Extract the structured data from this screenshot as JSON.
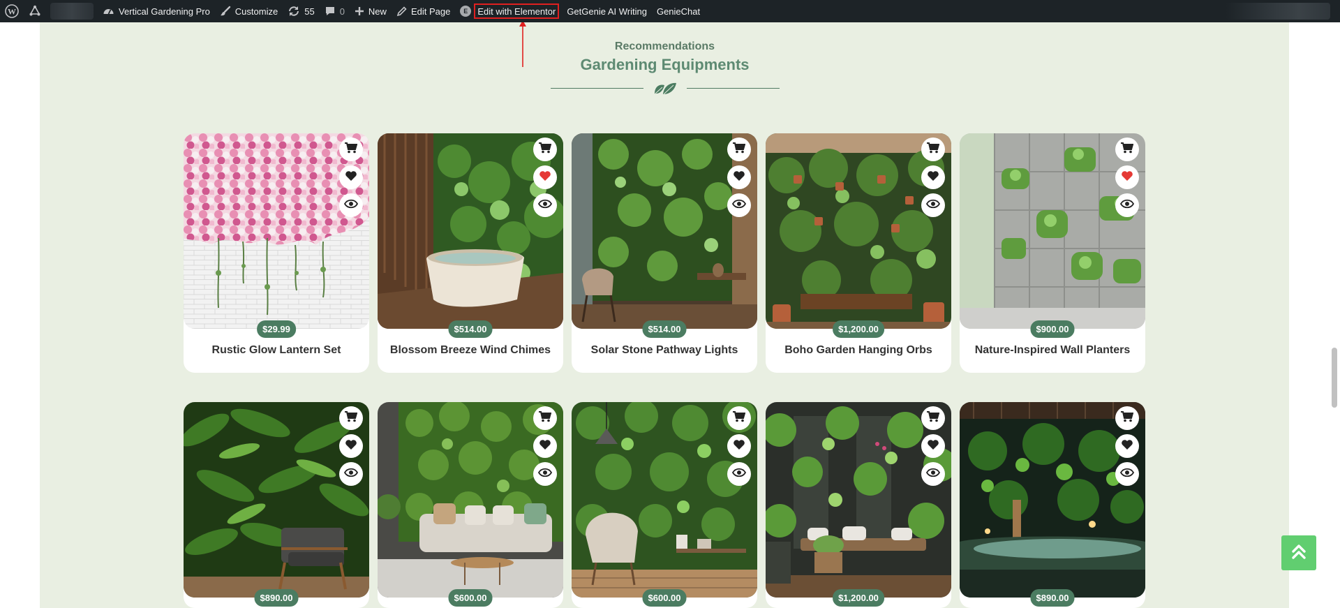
{
  "adminbar": {
    "site_name": "Vertical Gardening Pro",
    "customize": "Customize",
    "updates_count": "55",
    "comments_count": "0",
    "new": "New",
    "edit_page": "Edit Page",
    "elementor_badge": "E",
    "edit_elementor": "Edit with Elementor",
    "getgenie": "GetGenie AI Writing",
    "geniechat": "GenieChat"
  },
  "section": {
    "subtitle": "Recommendations",
    "title": "Gardening Equipments"
  },
  "colors": {
    "accent": "#4b7c61",
    "page_bg": "#e9efe2",
    "heart_active": "#e53935",
    "scroll_top": "#61ce70"
  },
  "products": [
    {
      "name": "Rustic Glow Lantern Set",
      "price": "$29.99",
      "wishlisted": false,
      "image": "pink-rose-wall-image"
    },
    {
      "name": "Blossom Breeze Wind Chimes",
      "price": "$514.00",
      "wishlisted": true,
      "image": "bathtub-green-wall-image"
    },
    {
      "name": "Solar Stone Pathway Lights",
      "price": "$514.00",
      "wishlisted": false,
      "image": "green-wall-chair-image"
    },
    {
      "name": "Boho Garden Hanging Orbs",
      "price": "$1,200.00",
      "wishlisted": false,
      "image": "potted-plant-wall-image"
    },
    {
      "name": "Nature-Inspired Wall Planters",
      "price": "$900.00",
      "wishlisted": true,
      "image": "concrete-wall-planters-image"
    },
    {
      "name": "",
      "price": "$890.00",
      "wishlisted": false,
      "image": "fern-wall-armchair-image"
    },
    {
      "name": "",
      "price": "$600.00",
      "wishlisted": false,
      "image": "living-room-green-wall-image"
    },
    {
      "name": "",
      "price": "$600.00",
      "wishlisted": false,
      "image": "lounge-chair-pendant-image"
    },
    {
      "name": "",
      "price": "$1,200.00",
      "wishlisted": false,
      "image": "patio-bench-planters-image"
    },
    {
      "name": "",
      "price": "$890.00",
      "wishlisted": false,
      "image": "spa-pool-green-wall-image"
    }
  ]
}
